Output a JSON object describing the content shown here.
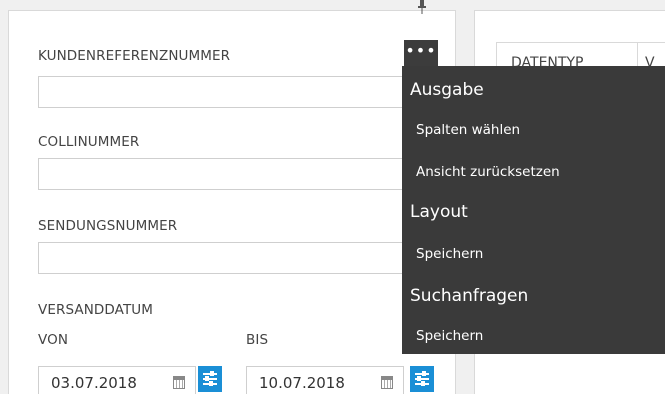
{
  "form": {
    "kundenreferenz_label": "KUNDENREFERENZNUMMER",
    "collinummer_label": "COLLINUMMER",
    "sendungsnummer_label": "SENDUNGSNUMMER",
    "versanddatum_label": "VERSANDDATUM",
    "von_label": "VON",
    "bis_label": "BIS",
    "von_value": "03.07.2018",
    "bis_value": "10.07.2018",
    "more_button": "•••"
  },
  "grid": {
    "columns": [
      "DATENTYP",
      "V"
    ]
  },
  "menu": {
    "sections": [
      {
        "title": "Ausgabe",
        "items": [
          "Spalten wählen",
          "Ansicht zurücksetzen"
        ]
      },
      {
        "title": "Layout",
        "items": [
          "Speichern"
        ]
      },
      {
        "title": "Suchanfragen",
        "items": [
          "Speichern"
        ]
      }
    ]
  },
  "colors": {
    "accent": "#1a8fd6",
    "menu_bg": "#3a3a3a"
  },
  "icons": [
    "pin-icon",
    "more-icon",
    "calendar-icon",
    "filter-icon"
  ]
}
